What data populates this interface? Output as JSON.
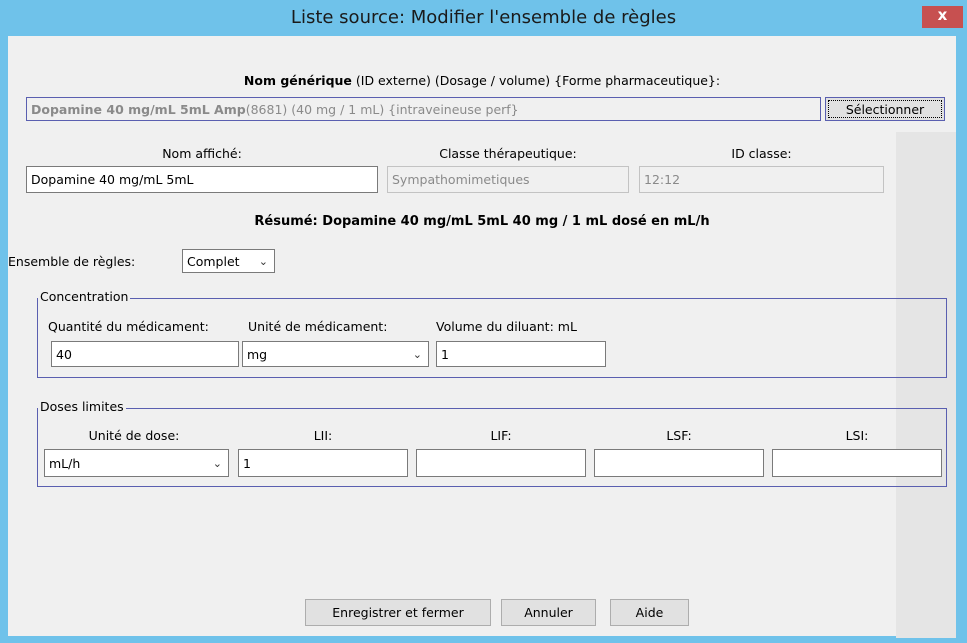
{
  "window": {
    "title": "Liste source:  Modifier l'ensemble de règles",
    "close_label": "x"
  },
  "generic": {
    "header_bold": "Nom générique",
    "header_rest": " (ID externe) (Dosage / volume) {Forme pharmaceutique}:",
    "value_bold": "Dopamine 40 mg/mL 5mL Amp",
    "value_rest": " (8681) (40 mg / 1 mL) {intraveineuse perf}",
    "select_button": "Sélectionner"
  },
  "display": {
    "name_label": "Nom affiché:",
    "name_value": "Dopamine 40 mg/mL  5mL",
    "class_label": "Classe thérapeutique:",
    "class_value": "Sympathomimetiques",
    "class_id_label": "ID classe:",
    "class_id_value": "12:12"
  },
  "summary": "Résumé: Dopamine 40 mg/mL  5mL 40 mg / 1 mL dosé en mL/h",
  "ruleset": {
    "label": "Ensemble de règles:",
    "value": "Complet"
  },
  "concentration": {
    "legend": "Concentration",
    "qty_label": "Quantité du médicament:",
    "qty_value": "40",
    "unit_label": "Unité de médicament:",
    "unit_value": "mg",
    "diluent_label": "Volume du diluant: mL",
    "diluent_value": "1"
  },
  "limits": {
    "legend": "Doses limites",
    "dose_unit_label": "Unité de dose:",
    "dose_unit_value": "mL/h",
    "lii_label": "LII:",
    "lii_value": "1",
    "lif_label": "LIF:",
    "lif_value": "",
    "lsf_label": "LSF:",
    "lsf_value": "",
    "lsi_label": "LSI:",
    "lsi_value": ""
  },
  "buttons": {
    "save": "Enregistrer et fermer",
    "cancel": "Annuler",
    "help": "Aide"
  },
  "icons": {
    "dropdown": "chevron-down-icon",
    "close": "close-icon"
  },
  "colors": {
    "title_bar": "#6fc2ea",
    "close_button": "#c75050",
    "group_border": "#5a5fb0"
  }
}
